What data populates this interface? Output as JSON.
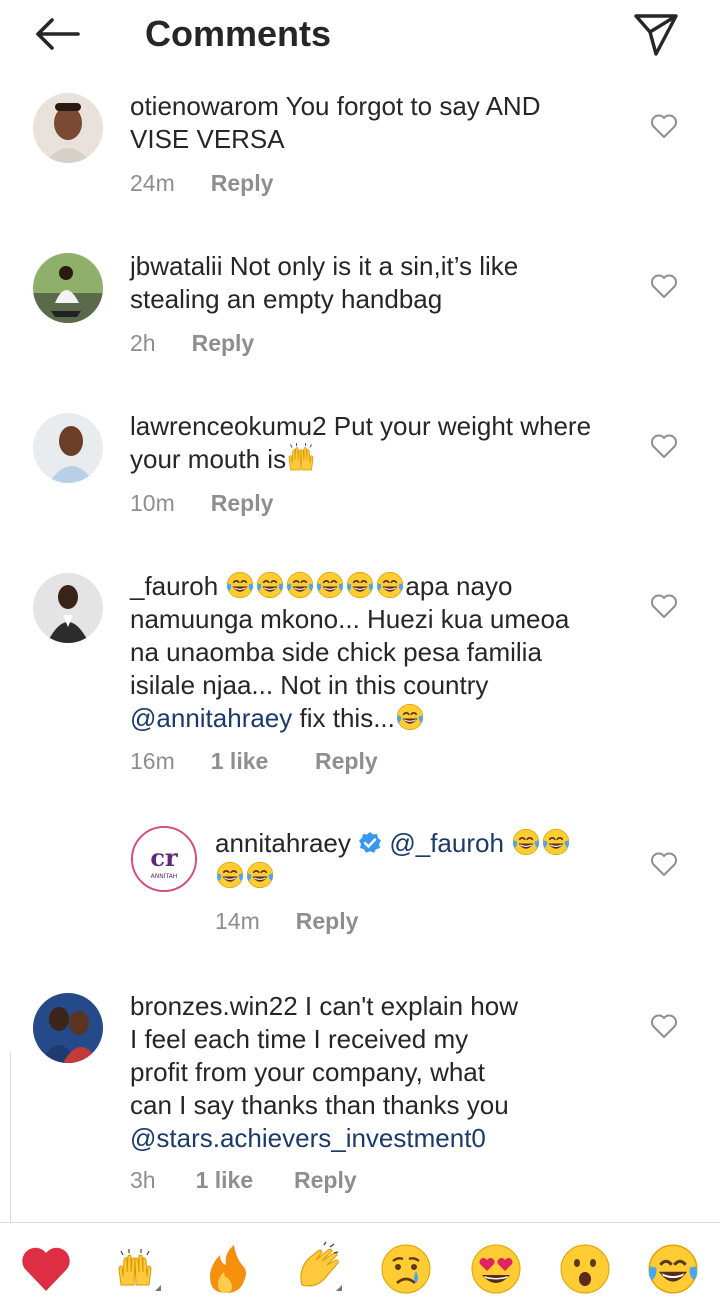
{
  "header": {
    "title": "Comments",
    "back_icon": "arrow-left-icon",
    "send_icon": "paper-plane-icon"
  },
  "comments": [
    {
      "username": "otienowarom",
      "text": "You forgot to say AND VISE VERSA",
      "line1": "You forgot to say AND",
      "line2": "VISE VERSA",
      "time": "24m",
      "reply": "Reply"
    },
    {
      "username": "jbwatalii",
      "line1": "Not only is it a sin,it’s like",
      "line2": "stealing an empty handbag",
      "time": "2h",
      "reply": "Reply"
    },
    {
      "username": "lawrenceokumu2",
      "line1": "Put your weight where",
      "line2": "your mouth is",
      "time": "10m",
      "reply": "Reply"
    },
    {
      "username": "_fauroh",
      "line1_suffix": "apa nayo",
      "line2": "namuunga mkono... Huezi kua umeoa",
      "line3": "na unaomba side chick pesa familia",
      "line4": "isilale njaa... Not in this country",
      "mention": "@annitahraey",
      "line5_suffix": " fix this...",
      "time": "16m",
      "likes": "1 like",
      "reply": "Reply"
    },
    {
      "username": "annitahraey",
      "verified": true,
      "mention": "@_fauroh",
      "time": "14m",
      "reply": "Reply",
      "avatar_logo_text": "ANNITAH"
    },
    {
      "username": "bronzes.win22",
      "line1": "I can't explain how",
      "line2": "I feel each time I received my",
      "line3": "profit from your company, what",
      "line4": "can I say thanks than thanks you",
      "mention": "@stars.achievers_investment0",
      "time": "3h",
      "likes": "1 like",
      "reply": "Reply"
    }
  ],
  "reactions": [
    "red-heart",
    "raising-hands",
    "fire",
    "clapping-hands",
    "crying-face",
    "heart-eyes-face",
    "surprised-face",
    "tears-of-joy-face"
  ],
  "colors": {
    "text": "#262626",
    "meta": "#8e8e8e",
    "mention": "#1b3a6b",
    "verified": "#3897f0"
  }
}
